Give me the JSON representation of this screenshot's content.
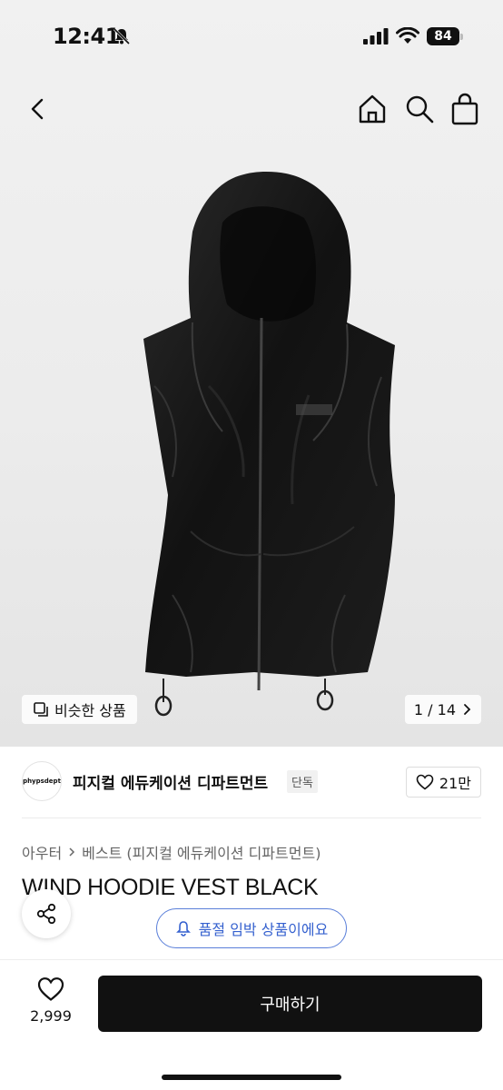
{
  "status": {
    "time": "12:41",
    "battery": "84"
  },
  "gallery": {
    "similar_label": "비슷한 상품",
    "pager": "1 / 14"
  },
  "brand": {
    "logo_text": "phypsdept",
    "name": "피지컬 에듀케이션 디파트먼트",
    "badge": "단독",
    "likes": "21만"
  },
  "breadcrumb": {
    "category": "아우터",
    "subcategory": "베스트 (피지컬 에듀케이션 디파트먼트)"
  },
  "product": {
    "title": "WIND HOODIE VEST BLACK"
  },
  "notice": {
    "soldout_label": "품절 임박 상품이에요"
  },
  "bottom_bar": {
    "wish_count": "2,999",
    "buy_label": "구매하기"
  },
  "icons": [
    "back-icon",
    "home-icon",
    "search-icon",
    "shopping-bag-icon",
    "copy-icon",
    "chevron-right-icon",
    "heart-icon",
    "share-icon",
    "bell-icon"
  ],
  "colors": {
    "accent_blue": "#3561cf",
    "buy_button": "#111111"
  }
}
